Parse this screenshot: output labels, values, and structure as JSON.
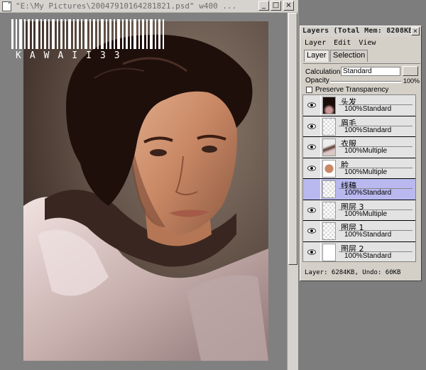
{
  "document": {
    "title": "\"E:\\My Pictures\\20047910164281821.psd\" w400 ..."
  },
  "watermark": {
    "text": "KAWAII33"
  },
  "palette": {
    "title": "Layers (Total Mem: 8208KB)",
    "close_label": "×",
    "menu": [
      "Layer",
      "Edit",
      "View"
    ],
    "tabs": [
      "Layer",
      "Selection"
    ],
    "calculation_label": "Calculation",
    "calculation_value": "Standard",
    "opacity_label": "Opacity",
    "opacity_value": "100%",
    "preserve_label": "Preserve Transparency",
    "layers": [
      {
        "name": "头发",
        "mode": "100%Standard",
        "selected": false,
        "visible": true,
        "thumb": "hair"
      },
      {
        "name": "眉毛",
        "mode": "100%Standard",
        "selected": false,
        "visible": true,
        "thumb": "blank"
      },
      {
        "name": "衣服",
        "mode": "100%Multiple",
        "selected": false,
        "visible": true,
        "thumb": "coat"
      },
      {
        "name": "脸",
        "mode": "100%Multiple",
        "selected": false,
        "visible": true,
        "thumb": "face"
      },
      {
        "name": "线稿",
        "mode": "100%Standard",
        "selected": true,
        "visible": false,
        "thumb": "blank"
      },
      {
        "name": "图层 3",
        "mode": "100%Multiple",
        "selected": false,
        "visible": true,
        "thumb": "blank"
      },
      {
        "name": "图层 1",
        "mode": "100%Standard",
        "selected": false,
        "visible": true,
        "thumb": "blank"
      },
      {
        "name": "图层 2",
        "mode": "100%Standard",
        "selected": false,
        "visible": true,
        "thumb": "white"
      }
    ],
    "status": "Layer: 6284KB, Undo: 60KB"
  }
}
